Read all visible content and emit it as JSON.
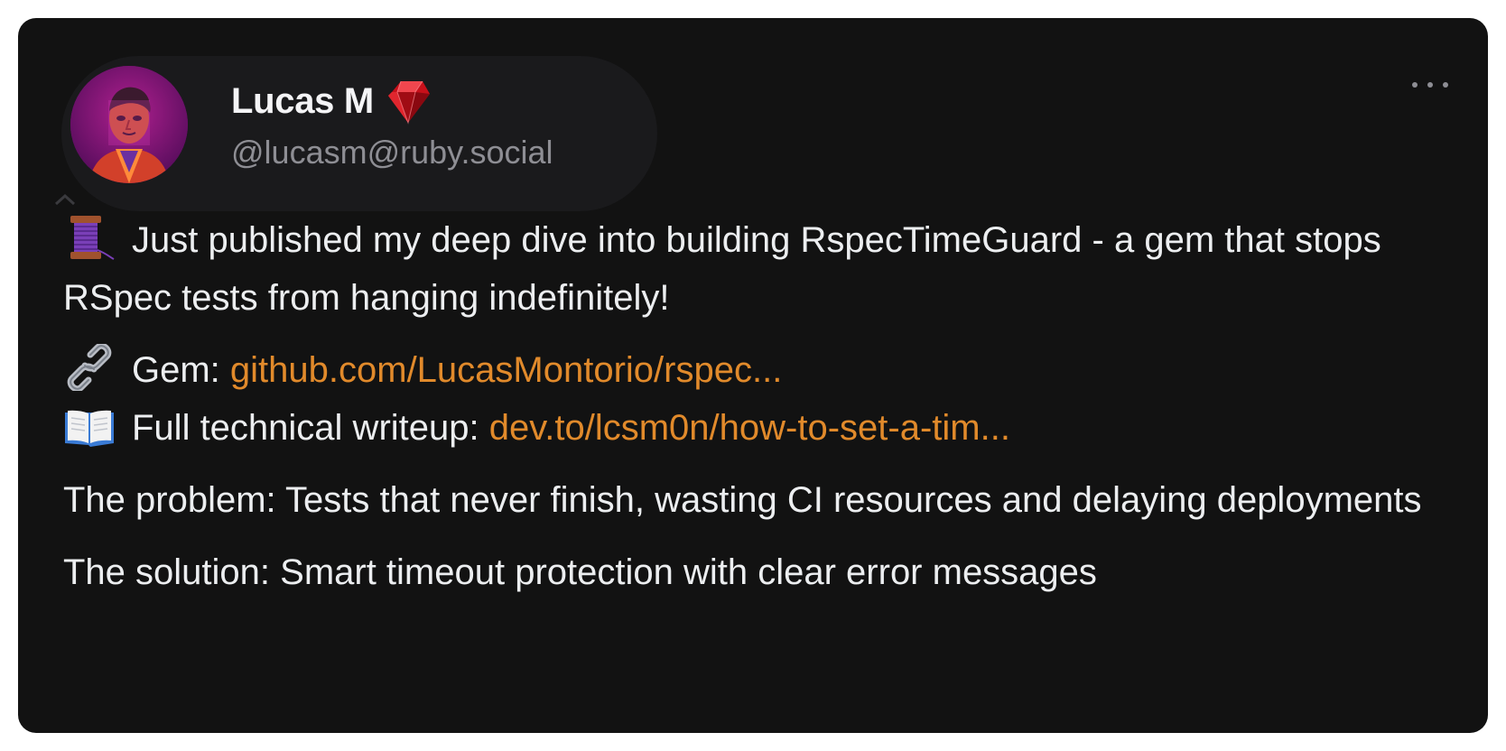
{
  "author": {
    "display_name": "Lucas M",
    "handle": "@lucasm@ruby.social",
    "avatar_icon": "avatar-portrait",
    "badge_icon": "ruby-gem-icon"
  },
  "post": {
    "intro_icon": "spool-of-thread-icon",
    "intro_text": "Just published my deep dive into building RspecTimeGuard - a gem that stops RSpec tests from hanging indefinitely!",
    "gem_icon": "link-icon",
    "gem_label": "Gem: ",
    "gem_link": "github.com/LucasMontorio/rspec...",
    "writeup_icon": "open-book-icon",
    "writeup_label": "Full technical writeup: ",
    "writeup_link": "dev.to/lcsm0n/how-to-set-a-tim...",
    "problem_text": "The problem: Tests that never finish, wasting CI resources and delaying deployments",
    "solution_text": "The solution: Smart timeout protection with clear error messages"
  },
  "colors": {
    "background": "#121212",
    "text": "#eceef0",
    "link": "#e18a2b",
    "muted": "#8e8e94"
  }
}
